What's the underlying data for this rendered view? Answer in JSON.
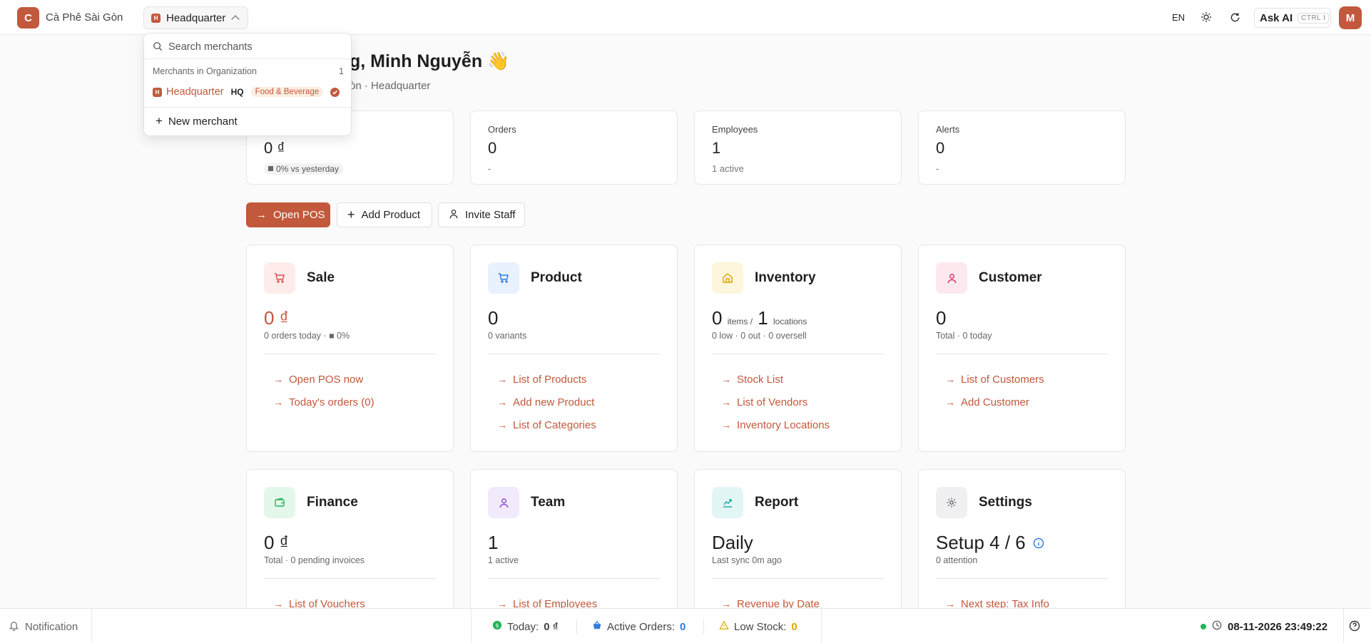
{
  "org": {
    "initial": "C",
    "name": "Cà Phê Sài Gòn"
  },
  "merchant_selector": {
    "badge": "H",
    "label": "Headquarter"
  },
  "topbar": {
    "lang": "EN",
    "ask_ai": "Ask AI",
    "shortcut": "CTRL I",
    "avatar": "M"
  },
  "greeting": {
    "title_tail": "g, Minh Nguyễn 👋",
    "subtitle_tail": "òn · Headquarter"
  },
  "stats": [
    {
      "label": "",
      "value": "0 ₫",
      "sub": "0% vs yesterday"
    },
    {
      "label": "Orders",
      "value": "0",
      "sub": "-"
    },
    {
      "label": "Employees",
      "value": "1",
      "sub": "1 active"
    },
    {
      "label": "Alerts",
      "value": "0",
      "sub": "-"
    }
  ],
  "actions": {
    "open_pos": "Open POS",
    "add_product": "Add Product",
    "invite_staff": "Invite Staff"
  },
  "modules": {
    "sale": {
      "title": "Sale",
      "metric": "0 ₫",
      "sub": "0 orders today · ■ 0%",
      "links": [
        "Open POS now",
        "Today's orders (0)"
      ]
    },
    "product": {
      "title": "Product",
      "metric": "0",
      "sub": "0 variants",
      "links": [
        "List of Products",
        "Add new Product",
        "List of Categories"
      ]
    },
    "inventory": {
      "title": "Inventory",
      "metric_items": "0",
      "items_label": "items /",
      "metric_locations": "1",
      "locations_label": "locations",
      "sub": "0 low · 0 out · 0 oversell",
      "links": [
        "Stock List",
        "List of Vendors",
        "Inventory Locations"
      ]
    },
    "customer": {
      "title": "Customer",
      "metric": "0",
      "sub": "Total · 0 today",
      "links": [
        "List of Customers",
        "Add Customer"
      ]
    },
    "finance": {
      "title": "Finance",
      "metric": "0 ₫",
      "sub": "Total · 0 pending invoices",
      "links": [
        "List of Vouchers"
      ]
    },
    "team": {
      "title": "Team",
      "metric": "1",
      "sub": "1 active",
      "links": [
        "List of Employees"
      ]
    },
    "report": {
      "title": "Report",
      "metric": "Daily",
      "sub": "Last sync 0m ago",
      "links": [
        "Revenue by Date"
      ]
    },
    "settings": {
      "title": "Settings",
      "metric": "Setup 4 / 6",
      "sub": "0 attention",
      "links": [
        "Next step: Tax Info"
      ]
    }
  },
  "bottombar": {
    "notification": "Notification",
    "today_label": "Today:",
    "today_value": "0 ₫",
    "active_orders_label": "Active Orders:",
    "active_orders_value": "0",
    "low_stock_label": "Low Stock:",
    "low_stock_value": "0",
    "datetime": "08-11-2026 23:49:22"
  },
  "dropdown": {
    "search_placeholder": "Search merchants",
    "section_label": "Merchants in Organization",
    "section_count": "1",
    "item": {
      "badge": "H",
      "name": "Headquarter",
      "code": "HQ",
      "tag": "Food & Beverage"
    },
    "new_label": "New merchant"
  },
  "colors": {
    "accent": "#c2583c",
    "success": "#22b55a",
    "info": "#2e7de0",
    "warning": "#e0a800"
  }
}
